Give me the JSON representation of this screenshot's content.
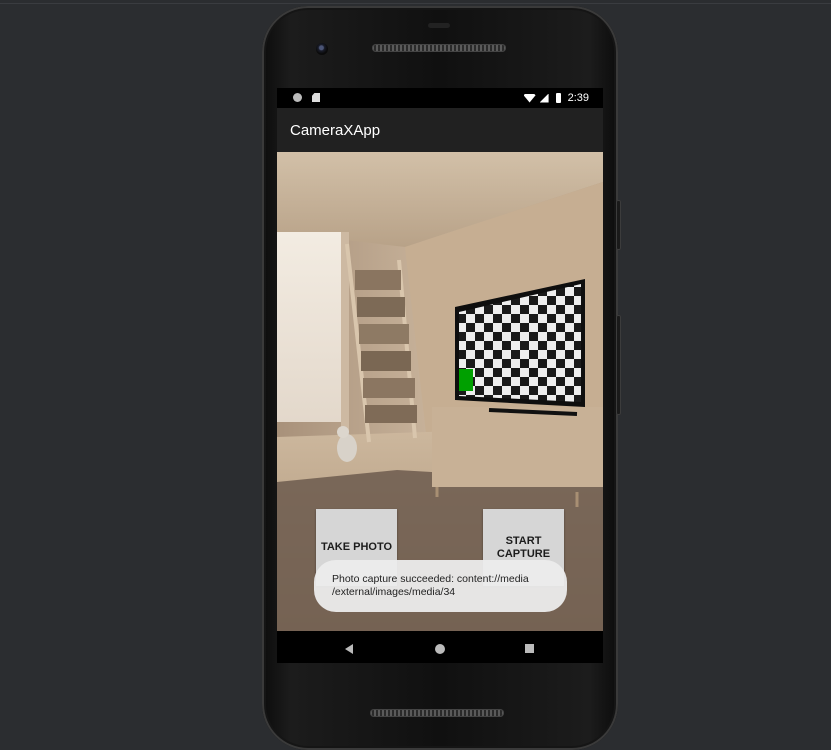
{
  "status_bar": {
    "time": "2:39",
    "icons": [
      "notification-dot-icon",
      "sd-card-icon",
      "wifi-icon",
      "signal-icon",
      "battery-icon"
    ]
  },
  "app": {
    "title": "CameraXApp"
  },
  "buttons": {
    "take_photo": "TAKE PHOTO",
    "start_capture": "START\nCAPTURE"
  },
  "toast": {
    "message": "Photo capture succeeded: content://media /external/images/media/34"
  },
  "nav": {
    "icons": [
      "back-icon",
      "home-icon",
      "recents-icon"
    ]
  },
  "colors": {
    "app_bar": "#212121",
    "button_bg": "#d6d6d6",
    "tv_marker": "#00a000"
  }
}
